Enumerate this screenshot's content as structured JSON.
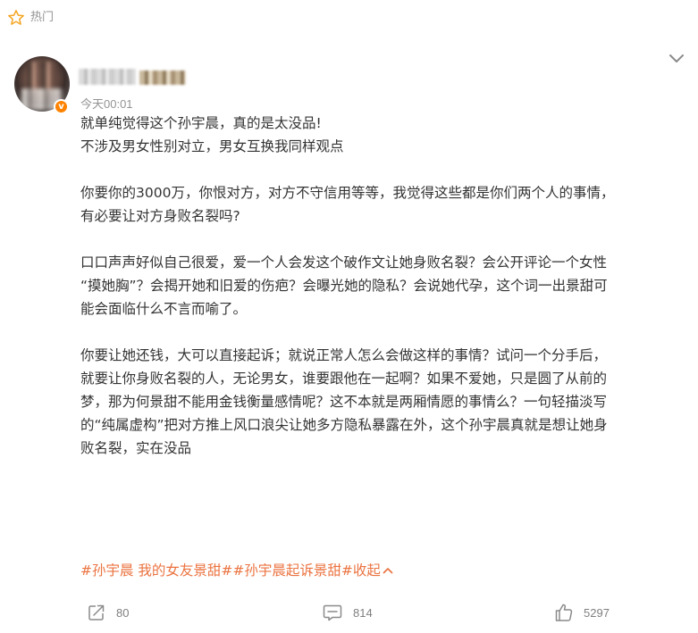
{
  "hot_tag": {
    "label": "热门",
    "icon": "star-outline-icon",
    "color": "#f5a623"
  },
  "post": {
    "author": {
      "avatar_icon": "avatar",
      "verified_badge": "v",
      "verified_color": "#ff8200"
    },
    "time": "今天00:01",
    "paragraphs": [
      [
        "就单纯觉得这个孙宇晨，真的是太没品!",
        "不涉及男女性别对立，男女互换我同样观点"
      ],
      [
        "你要你的3000万，你恨对方，对方不守信用等等，我觉得这些都是你们两个人的事情，",
        "有必要让对方身败名裂吗?"
      ],
      [
        "口口声声好似自己很爱，爱一个人会发这个破作文让她身败名裂？会公开评论一个女性",
        "“摸她胸”？会揭开她和旧爱的伤疤？会曝光她的隐私？会说她代孕，这个词一出景甜可",
        "能会面临什么不言而喻了。"
      ],
      [
        "你要让她还钱，大可以直接起诉；就说正常人怎么会做这样的事情？试问一个分手后，",
        "就要让你身败名裂的人，无论男女，谁要跟他在一起啊？如果不爱她，只是圆了从前的",
        "梦，那为何景甜不能用金钱衡量感情呢？这不本就是两厢情愿的事情么？一句轻描淡写",
        "的“纯属虚构”把对方推上风口浪尖让她多方隐私暴露在外，这个孙宇晨真就是想让她身",
        "败名裂，实在没品"
      ]
    ],
    "hashtags": [
      "#孙宇晨 我的女友景甜#",
      "#孙宇晨起诉景甜#"
    ],
    "collapse_label": "收起",
    "link_color": "#eb7340"
  },
  "actions": {
    "forward": {
      "count": "80",
      "icon": "forward-icon"
    },
    "comment": {
      "count": "814",
      "icon": "comment-icon"
    },
    "like": {
      "count": "5297",
      "icon": "thumbs-up-icon"
    }
  }
}
